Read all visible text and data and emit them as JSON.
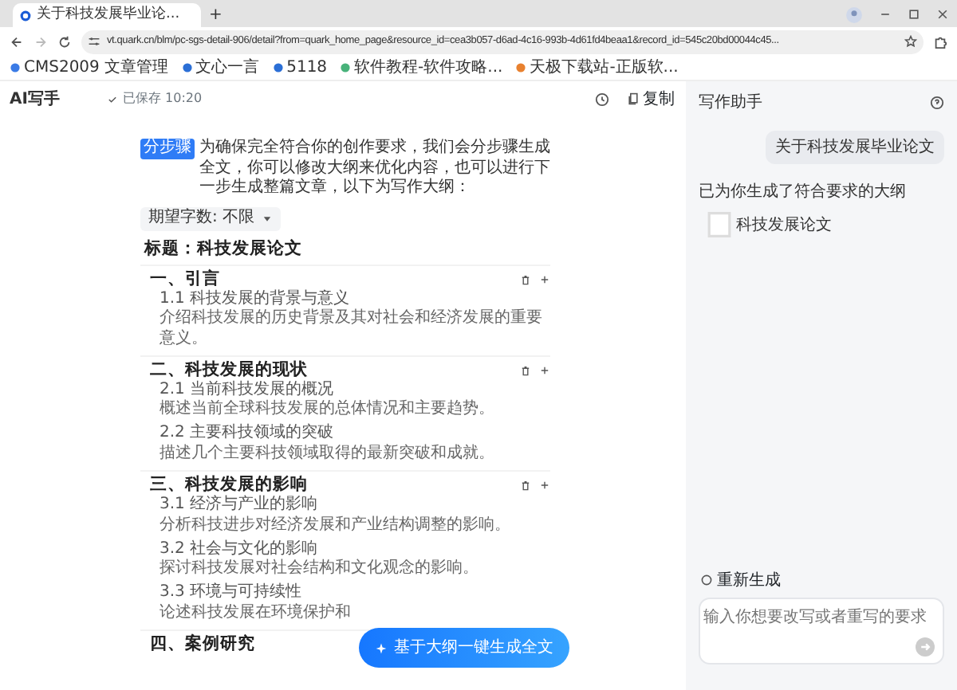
{
  "browser": {
    "tab_title": "关于科技发展毕业论...",
    "new_tab": "+",
    "url": "vt.quark.cn/blm/pc-sgs-detail-906/detail?from=quark_home_page&resource_id=cea3b057-d6ad-4c16-993b-4d61fd4beaa1&record_id=545c20bd00044c45...",
    "bookmarks": [
      "CMS2009 文章管理",
      "文心一言",
      "5118",
      "软件教程-软件攻略...",
      "天极下载站-正版软..."
    ]
  },
  "app": {
    "title": "AI写手",
    "saved": "已保存 10:20",
    "copy": "复制"
  },
  "intro": {
    "badge": "分步骤",
    "text": "为确保完全符合你的创作要求，我们会分步骤生成全文，你可以修改大纲来优化内容，也可以进行下一步生成整篇文章，以下为写作大纲："
  },
  "word_count": "期望字数: 不限",
  "outline_title": "标题：科技发展论文",
  "sections": [
    {
      "heading": "一、引言",
      "items": [
        {
          "title": "1.1 科技发展的背景与意义",
          "desc": "介绍科技发展的历史背景及其对社会和经济发展的重要意义。"
        }
      ]
    },
    {
      "heading": "二、科技发展的现状",
      "items": [
        {
          "title": "2.1 当前科技发展的概况",
          "desc": "概述当前全球科技发展的总体情况和主要趋势。"
        },
        {
          "title": "2.2 主要科技领域的突破",
          "desc": "描述几个主要科技领域取得的最新突破和成就。"
        }
      ]
    },
    {
      "heading": "三、科技发展的影响",
      "items": [
        {
          "title": "3.1 经济与产业的影响",
          "desc": "分析科技进步对经济发展和产业结构调整的影响。"
        },
        {
          "title": "3.2 社会与文化的影响",
          "desc": "探讨科技发展对社会结构和文化观念的影响。"
        },
        {
          "title": "3.3 环境与可持续性",
          "desc": "论述科技发展在环境保护和"
        }
      ]
    },
    {
      "heading": "四、案例研究"
    }
  ],
  "generate_button": "基于大纲一键生成全文",
  "assistant": {
    "title": "写作助手",
    "user_message": "关于科技发展毕业论文",
    "reply": "已为你生成了符合要求的大纲",
    "doc_title": "科技发展论文",
    "regenerate": "重新生成",
    "input_placeholder": "输入你想要改写或者重写的要求"
  }
}
